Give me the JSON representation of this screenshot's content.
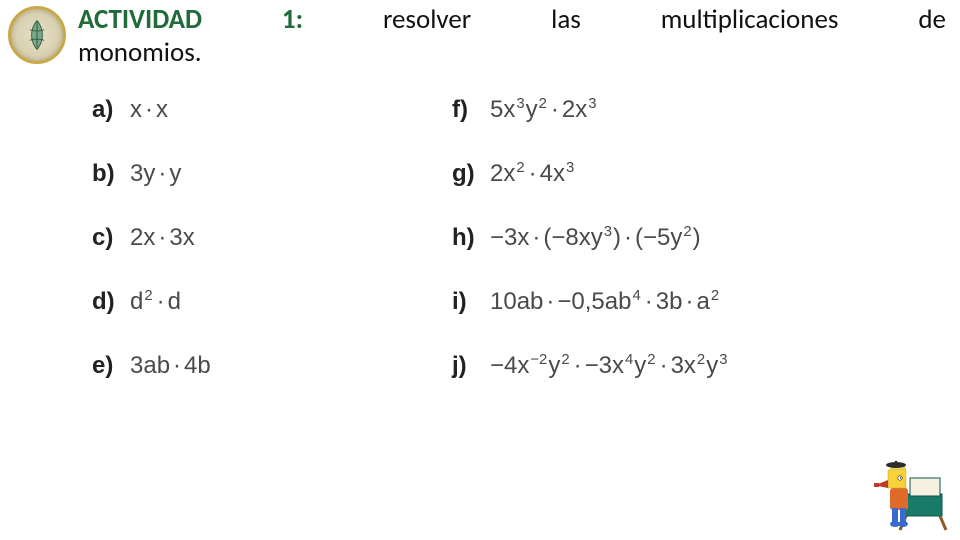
{
  "title": {
    "highlight": "ACTIVIDAD 1:",
    "rest_line1": "resolver las multiplicaciones de",
    "line2": "monomios."
  },
  "problems": {
    "left": [
      {
        "label": "a)",
        "expr": "x · x"
      },
      {
        "label": "b)",
        "expr": "3y · y"
      },
      {
        "label": "c)",
        "expr": "2x · 3x"
      },
      {
        "label": "d)",
        "expr": "d^2 · d"
      },
      {
        "label": "e)",
        "expr": "3ab · 4b"
      }
    ],
    "right": [
      {
        "label": "f)",
        "expr": "5x^3y^2 · 2x^3"
      },
      {
        "label": "g)",
        "expr": "2x^2 · 4x^3"
      },
      {
        "label": "h)",
        "expr": "−3x · (−8xy^3) · (−5y^2)"
      },
      {
        "label": "i)",
        "expr": "10ab · −0,5ab^4 · 3b · a^2"
      },
      {
        "label": "j)",
        "expr": "−4x^{−2}y^2 · −3x^4y^2 · 3x^2y^3"
      }
    ]
  },
  "icons": {
    "logo": "school-crest-icon",
    "cartoon": "bart-director-icon"
  }
}
